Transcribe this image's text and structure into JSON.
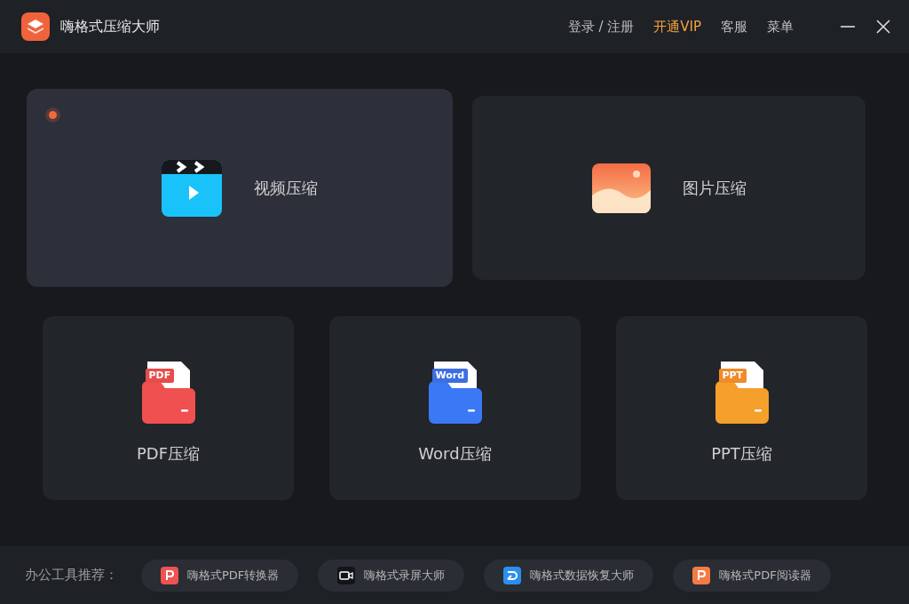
{
  "window": {
    "title": "嗨格式压缩大师",
    "nav": [
      {
        "label": "登录 / 注册",
        "kind": "plain"
      },
      {
        "label": "开通VIP",
        "kind": "vip"
      },
      {
        "label": "客服",
        "kind": "plain"
      },
      {
        "label": "菜单",
        "kind": "plain"
      }
    ]
  },
  "top_cards": [
    {
      "kind": "video",
      "label": "视频压缩",
      "selected": true
    },
    {
      "kind": "image",
      "label": "图片压缩",
      "selected": false
    }
  ],
  "file_cards": [
    {
      "kind": "pdf",
      "badge": "PDF",
      "label": "PDF压缩",
      "color": "#f0504f"
    },
    {
      "kind": "word",
      "badge": "Word",
      "label": "Word压缩",
      "color": "#3b78f5"
    },
    {
      "kind": "ppt",
      "badge": "PPT",
      "label": "PPT压缩",
      "color": "#f5a02a"
    }
  ],
  "footer": {
    "label": "办公工具推荐：",
    "tools": [
      {
        "kind": "pdf",
        "label": "嗨格式PDF转换器"
      },
      {
        "kind": "recorder",
        "label": "嗨格式录屏大师"
      },
      {
        "kind": "recovery",
        "label": "嗨格式数据恢复大师"
      },
      {
        "kind": "reader",
        "label": "嗨格式PDF阅读器"
      }
    ]
  }
}
